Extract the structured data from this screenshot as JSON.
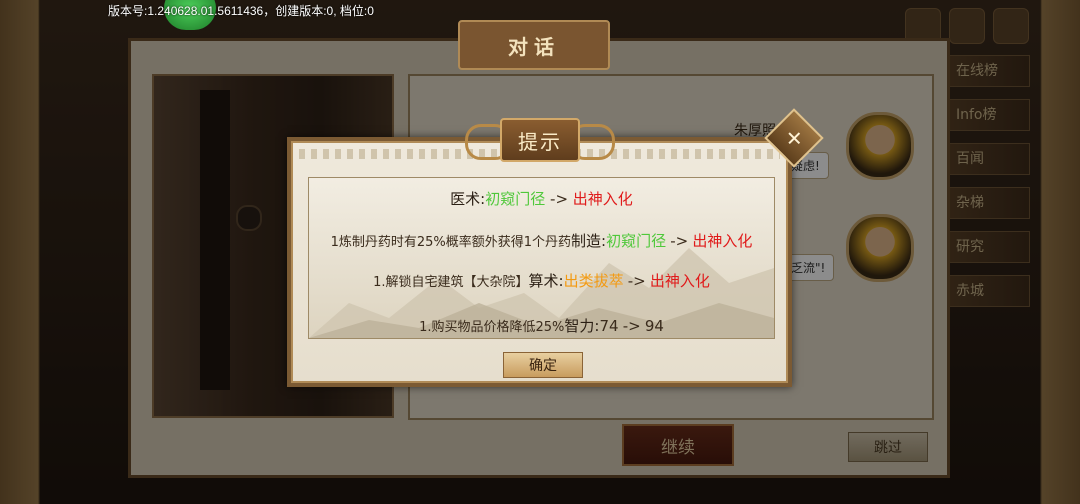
{
  "status_bar": {
    "version_text": "版本号:1.240628.01.5611436，创建版本:0, 档位:0"
  },
  "side_menu": {
    "items": [
      "在线榜",
      "Info榜",
      "百闻",
      "杂梯",
      "研究",
      "赤城"
    ]
  },
  "dialogue_window": {
    "title": "对话",
    "speaker_name": "朱厚照",
    "bubbles": [
      "疑虑!",
      "乏流\"!"
    ],
    "continue_label": "继续",
    "skip_label": "跳过"
  },
  "tip_popup": {
    "title": "提示",
    "close_label": "✕",
    "arrow": "->",
    "lines": [
      {
        "prefix": "",
        "skill": "医术:",
        "from": "初窥门径",
        "from_color": "green",
        "to": "出神入化"
      },
      {
        "prefix": "1炼制丹药时有25%概率额外获得1个丹药",
        "skill": "制造:",
        "from": "初窥门径",
        "from_color": "green",
        "to": "出神入化"
      },
      {
        "prefix": "1.解锁自宅建筑【大杂院】",
        "skill": "算术:",
        "from": "出类拔萃",
        "from_color": "orange",
        "to": "出神入化"
      },
      {
        "prefix": "1.购买物品价格降低25%",
        "skill": "智力:",
        "from": "74",
        "from_color": "plain",
        "to": "94"
      }
    ],
    "confirm_label": "确定"
  },
  "colors": {
    "green_level": "#4fc83a",
    "red_level": "#e01b1b",
    "orange_level": "#f39a11",
    "frame_brown": "#7b5a33"
  }
}
